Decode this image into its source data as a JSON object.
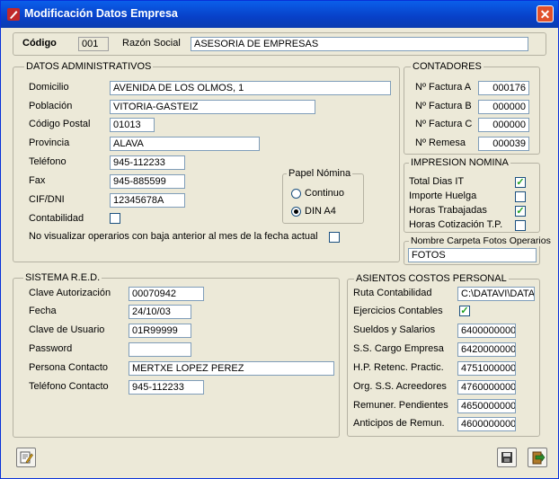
{
  "window": {
    "title": "Modificación Datos Empresa",
    "close_glyph": "✕"
  },
  "header": {
    "codigo_label": "Código",
    "codigo_value": "001",
    "razon_label": "Razón Social",
    "razon_value": "ASESORIA DE EMPRESAS"
  },
  "admin": {
    "title": "DATOS ADMINISTRATIVOS",
    "domicilio_label": "Domicilio",
    "domicilio": "AVENIDA DE LOS OLMOS, 1",
    "poblacion_label": "Población",
    "poblacion": "VITORIA-GASTEIZ",
    "cp_label": "Código Postal",
    "cp": "01013",
    "provincia_label": "Provincia",
    "provincia": "ALAVA",
    "telefono_label": "Teléfono",
    "telefono": "945-112233",
    "fax_label": "Fax",
    "fax": "945-885599",
    "cif_label": "CIF/DNI",
    "cif": "12345678A",
    "contabilidad_label": "Contabilidad",
    "contabilidad_checked": false,
    "no_visualizar_label": "No visualizar operarios con baja anterior al mes de la fecha actual",
    "no_visualizar_checked": false
  },
  "papel": {
    "title": "Papel Nómina",
    "continuo": "Continuo",
    "dina4": "DIN A4",
    "selected": "DIN A4"
  },
  "contadores": {
    "title": "CONTADORES",
    "items": [
      {
        "label": "Nº Factura  A",
        "value": "000176"
      },
      {
        "label": "Nº Factura  B",
        "value": "000000"
      },
      {
        "label": "Nº Factura  C",
        "value": "000000"
      },
      {
        "label": "Nº Remesa",
        "value": "000039"
      }
    ]
  },
  "impresion": {
    "title": "IMPRESION NOMINA",
    "items": [
      {
        "label": "Total Dias IT",
        "checked": true
      },
      {
        "label": "Importe Huelga",
        "checked": false
      },
      {
        "label": "Horas Trabajadas",
        "checked": true
      },
      {
        "label": "Horas Cotización T.P.",
        "checked": false
      }
    ]
  },
  "carpeta": {
    "title": "Nombre Carpeta Fotos Operarios",
    "value": "FOTOS"
  },
  "red": {
    "title": "SISTEMA R.E.D.",
    "clave_label": "Clave Autorización",
    "clave": "00070942",
    "fecha_label": "Fecha",
    "fecha": "24/10/03",
    "usuario_label": "Clave de Usuario",
    "usuario": "01R99999",
    "password_label": "Password",
    "password": "",
    "persona_label": "Persona Contacto",
    "persona": "MERTXE LOPEZ PEREZ",
    "tel_label": "Teléfono Contacto",
    "tel": "945-112233"
  },
  "asientos": {
    "title": "ASIENTOS COSTOS PERSONAL",
    "ruta_label": "Ruta Contabilidad",
    "ruta": "C:\\DATAVI\\DATA",
    "ejercicios_label": "Ejercicios Contables",
    "ejercicios_checked": true,
    "items": [
      {
        "label": "Sueldos y Salarios",
        "value": "6400000000"
      },
      {
        "label": "S.S. Cargo Empresa",
        "value": "6420000000"
      },
      {
        "label": "H.P. Retenc. Practic.",
        "value": "4751000000"
      },
      {
        "label": "Org. S.S. Acreedores",
        "value": "4760000000"
      },
      {
        "label": "Remuner. Pendientes",
        "value": "4650000000"
      },
      {
        "label": "Anticipos de Remun.",
        "value": "4600000000"
      }
    ]
  },
  "icons": {
    "app": "pencil-icon",
    "help": "help-edit-icon",
    "save": "floppy-disk-icon",
    "exit": "exit-door-icon"
  }
}
